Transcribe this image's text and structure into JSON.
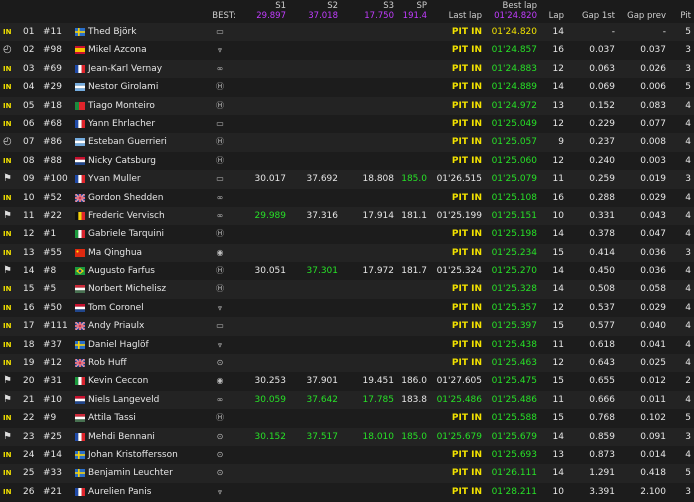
{
  "header": {
    "best_label": "BEST:",
    "col_s1": "S1",
    "col_s2": "S2",
    "col_s3": "S3",
    "col_sp": "SP",
    "col_last_lap": "Last lap",
    "col_best_lap": "Best lap",
    "col_lap": "Lap",
    "col_gap1": "Gap 1st",
    "col_gap_prev": "Gap prev",
    "col_pit": "Pit",
    "best_s1": "29.897",
    "best_s2": "37.018",
    "best_s3": "17.750",
    "best_sp": "191.4",
    "best_lap": "01'24.820"
  },
  "colors": {
    "pit_in": "#f2e200",
    "personal_best": "#27e027",
    "overall_best": "#c13cff",
    "row_odd": "#232323",
    "row_even": "#1c1c1c"
  },
  "rows": [
    {
      "status": "IN",
      "status_type": "pit",
      "pos": "01",
      "num": "#11",
      "flag": "SE",
      "name": "Thed Björk",
      "brand": "lynk",
      "s1": "",
      "s2": "",
      "s3": "",
      "sp": "",
      "last": "PIT IN",
      "best": "01'24.820",
      "best_color": "yellow",
      "lap": "14",
      "gap1": "-",
      "gap2": "-",
      "pit": "5"
    },
    {
      "status": "◴",
      "status_type": "icon",
      "pos": "02",
      "num": "#98",
      "flag": "ES",
      "name": "Mikel Azcona",
      "brand": "cupra",
      "s1": "",
      "s2": "",
      "s3": "",
      "sp": "",
      "last": "PIT IN",
      "best": "01'24.857",
      "best_color": "green",
      "lap": "16",
      "gap1": "0.037",
      "gap2": "0.037",
      "pit": "3"
    },
    {
      "status": "IN",
      "status_type": "pit",
      "pos": "03",
      "num": "#69",
      "flag": "FR",
      "name": "Jean-Karl Vernay",
      "brand": "audi",
      "s1": "",
      "s2": "",
      "s3": "",
      "sp": "",
      "last": "PIT IN",
      "best": "01'24.883",
      "best_color": "green",
      "lap": "12",
      "gap1": "0.063",
      "gap2": "0.026",
      "pit": "3"
    },
    {
      "status": "IN",
      "status_type": "pit",
      "pos": "04",
      "num": "#29",
      "flag": "AR",
      "name": "Nestor Girolami",
      "brand": "honda",
      "s1": "",
      "s2": "",
      "s3": "",
      "sp": "",
      "last": "PIT IN",
      "best": "01'24.889",
      "best_color": "green",
      "lap": "14",
      "gap1": "0.069",
      "gap2": "0.006",
      "pit": "5"
    },
    {
      "status": "IN",
      "status_type": "pit",
      "pos": "05",
      "num": "#18",
      "flag": "PT",
      "name": "Tiago Monteiro",
      "brand": "honda",
      "s1": "",
      "s2": "",
      "s3": "",
      "sp": "",
      "last": "PIT IN",
      "best": "01'24.972",
      "best_color": "green",
      "lap": "13",
      "gap1": "0.152",
      "gap2": "0.083",
      "pit": "4"
    },
    {
      "status": "IN",
      "status_type": "pit",
      "pos": "06",
      "num": "#68",
      "flag": "FR",
      "name": "Yann Ehrlacher",
      "brand": "lynk",
      "s1": "",
      "s2": "",
      "s3": "",
      "sp": "",
      "last": "PIT IN",
      "best": "01'25.049",
      "best_color": "green",
      "lap": "12",
      "gap1": "0.229",
      "gap2": "0.077",
      "pit": "4"
    },
    {
      "status": "◴",
      "status_type": "icon",
      "pos": "07",
      "num": "#86",
      "flag": "AR",
      "name": "Esteban Guerrieri",
      "brand": "honda",
      "s1": "",
      "s2": "",
      "s3": "",
      "sp": "",
      "last": "PIT IN",
      "best": "01'25.057",
      "best_color": "green",
      "lap": "9",
      "gap1": "0.237",
      "gap2": "0.008",
      "pit": "4"
    },
    {
      "status": "IN",
      "status_type": "pit",
      "pos": "08",
      "num": "#88",
      "flag": "NL",
      "name": "Nicky Catsburg",
      "brand": "hyundai",
      "s1": "",
      "s2": "",
      "s3": "",
      "sp": "",
      "last": "PIT IN",
      "best": "01'25.060",
      "best_color": "green",
      "lap": "12",
      "gap1": "0.240",
      "gap2": "0.003",
      "pit": "4"
    },
    {
      "status": "⚑",
      "status_type": "icon",
      "pos": "09",
      "num": "#100",
      "flag": "FR",
      "name": "Yvan Muller",
      "brand": "lynk",
      "s1": "30.017",
      "s1_color": "white",
      "s2": "37.692",
      "s2_color": "white",
      "s3": "18.808",
      "s3_color": "white",
      "sp": "185.0",
      "sp_color": "green",
      "last": "01'26.515",
      "last_color": "white",
      "best": "01'25.079",
      "best_color": "green",
      "lap": "11",
      "gap1": "0.259",
      "gap2": "0.019",
      "pit": "3"
    },
    {
      "status": "IN",
      "status_type": "pit",
      "pos": "10",
      "num": "#52",
      "flag": "GB",
      "name": "Gordon Shedden",
      "brand": "audi",
      "s1": "",
      "s2": "",
      "s3": "",
      "sp": "",
      "last": "PIT IN",
      "best": "01'25.108",
      "best_color": "green",
      "lap": "16",
      "gap1": "0.288",
      "gap2": "0.029",
      "pit": "4"
    },
    {
      "status": "⚑",
      "status_type": "icon",
      "pos": "11",
      "num": "#22",
      "flag": "BE",
      "name": "Frederic Vervisch",
      "brand": "audi",
      "s1": "29.989",
      "s1_color": "green",
      "s2": "37.316",
      "s2_color": "white",
      "s3": "17.914",
      "s3_color": "white",
      "sp": "181.1",
      "sp_color": "white",
      "last": "01'25.199",
      "last_color": "white",
      "best": "01'25.151",
      "best_color": "green",
      "lap": "10",
      "gap1": "0.331",
      "gap2": "0.043",
      "pit": "4"
    },
    {
      "status": "IN",
      "status_type": "pit",
      "pos": "12",
      "num": "#1",
      "flag": "IT",
      "name": "Gabriele Tarquini",
      "brand": "hyundai",
      "s1": "",
      "s2": "",
      "s3": "",
      "sp": "",
      "last": "PIT IN",
      "best": "01'25.198",
      "best_color": "green",
      "lap": "14",
      "gap1": "0.378",
      "gap2": "0.047",
      "pit": "4"
    },
    {
      "status": "IN",
      "status_type": "pit",
      "pos": "13",
      "num": "#55",
      "flag": "CN",
      "name": "Ma Qinghua",
      "brand": "alfa",
      "s1": "",
      "s2": "",
      "s3": "",
      "sp": "",
      "last": "PIT IN",
      "best": "01'25.234",
      "best_color": "green",
      "lap": "15",
      "gap1": "0.414",
      "gap2": "0.036",
      "pit": "3"
    },
    {
      "status": "⚑",
      "status_type": "icon",
      "pos": "14",
      "num": "#8",
      "flag": "BR",
      "name": "Augusto Farfus",
      "brand": "hyundai",
      "s1": "30.051",
      "s1_color": "white",
      "s2": "37.301",
      "s2_color": "green",
      "s3": "17.972",
      "s3_color": "white",
      "sp": "181.7",
      "sp_color": "white",
      "last": "01'25.324",
      "last_color": "white",
      "best": "01'25.270",
      "best_color": "green",
      "lap": "14",
      "gap1": "0.450",
      "gap2": "0.036",
      "pit": "4"
    },
    {
      "status": "IN",
      "status_type": "pit",
      "pos": "15",
      "num": "#5",
      "flag": "HU",
      "name": "Norbert Michelisz",
      "brand": "hyundai",
      "s1": "",
      "s2": "",
      "s3": "",
      "sp": "",
      "last": "PIT IN",
      "best": "01'25.328",
      "best_color": "green",
      "lap": "14",
      "gap1": "0.508",
      "gap2": "0.058",
      "pit": "4"
    },
    {
      "status": "IN",
      "status_type": "pit",
      "pos": "16",
      "num": "#50",
      "flag": "NL",
      "name": "Tom Coronel",
      "brand": "cupra",
      "s1": "",
      "s2": "",
      "s3": "",
      "sp": "",
      "last": "PIT IN",
      "best": "01'25.357",
      "best_color": "green",
      "lap": "12",
      "gap1": "0.537",
      "gap2": "0.029",
      "pit": "4"
    },
    {
      "status": "IN",
      "status_type": "pit",
      "pos": "17",
      "num": "#111",
      "flag": "GB",
      "name": "Andy Priaulx",
      "brand": "lynk",
      "s1": "",
      "s2": "",
      "s3": "",
      "sp": "",
      "last": "PIT IN",
      "best": "01'25.397",
      "best_color": "green",
      "lap": "15",
      "gap1": "0.577",
      "gap2": "0.040",
      "pit": "4"
    },
    {
      "status": "IN",
      "status_type": "pit",
      "pos": "18",
      "num": "#37",
      "flag": "SE",
      "name": "Daniel Haglöf",
      "brand": "cupra",
      "s1": "",
      "s2": "",
      "s3": "",
      "sp": "",
      "last": "PIT IN",
      "best": "01'25.438",
      "best_color": "green",
      "lap": "11",
      "gap1": "0.618",
      "gap2": "0.041",
      "pit": "4"
    },
    {
      "status": "IN",
      "status_type": "pit",
      "pos": "19",
      "num": "#12",
      "flag": "GB",
      "name": "Rob Huff",
      "brand": "vw",
      "s1": "",
      "s2": "",
      "s3": "",
      "sp": "",
      "last": "PIT IN",
      "best": "01'25.463",
      "best_color": "green",
      "lap": "12",
      "gap1": "0.643",
      "gap2": "0.025",
      "pit": "4"
    },
    {
      "status": "⚑",
      "status_type": "icon",
      "pos": "20",
      "num": "#31",
      "flag": "IT",
      "name": "Kevin Ceccon",
      "brand": "alfa",
      "s1": "30.253",
      "s1_color": "white",
      "s2": "37.901",
      "s2_color": "white",
      "s3": "19.451",
      "s3_color": "white",
      "sp": "186.0",
      "sp_color": "white",
      "last": "01'27.605",
      "last_color": "white",
      "best": "01'25.475",
      "best_color": "green",
      "lap": "15",
      "gap1": "0.655",
      "gap2": "0.012",
      "pit": "2"
    },
    {
      "status": "⚑",
      "status_type": "icon",
      "pos": "21",
      "num": "#10",
      "flag": "NL",
      "name": "Niels Langeveld",
      "brand": "audi",
      "s1": "30.059",
      "s1_color": "green",
      "s2": "37.642",
      "s2_color": "green",
      "s3": "17.785",
      "s3_color": "green",
      "sp": "183.8",
      "sp_color": "white",
      "last": "01'25.486",
      "last_color": "green",
      "best": "01'25.486",
      "best_color": "green",
      "lap": "11",
      "gap1": "0.666",
      "gap2": "0.011",
      "pit": "4"
    },
    {
      "status": "IN",
      "status_type": "pit",
      "pos": "22",
      "num": "#9",
      "flag": "HU",
      "name": "Attila Tassi",
      "brand": "honda",
      "s1": "",
      "s2": "",
      "s3": "",
      "sp": "",
      "last": "PIT IN",
      "best": "01'25.588",
      "best_color": "green",
      "lap": "15",
      "gap1": "0.768",
      "gap2": "0.102",
      "pit": "5"
    },
    {
      "status": "⚑",
      "status_type": "icon",
      "pos": "23",
      "num": "#25",
      "flag": "FR",
      "name": "Mehdi Bennani",
      "brand": "vw",
      "s1": "30.152",
      "s1_color": "green",
      "s2": "37.517",
      "s2_color": "green",
      "s3": "18.010",
      "s3_color": "green",
      "sp": "185.0",
      "sp_color": "green",
      "last": "01'25.679",
      "last_color": "green",
      "best": "01'25.679",
      "best_color": "green",
      "lap": "14",
      "gap1": "0.859",
      "gap2": "0.091",
      "pit": "3"
    },
    {
      "status": "IN",
      "status_type": "pit",
      "pos": "24",
      "num": "#14",
      "flag": "SE",
      "name": "Johan Kristoffersson",
      "brand": "vw",
      "s1": "",
      "s2": "",
      "s3": "",
      "sp": "",
      "last": "PIT IN",
      "best": "01'25.693",
      "best_color": "green",
      "lap": "13",
      "gap1": "0.873",
      "gap2": "0.014",
      "pit": "4"
    },
    {
      "status": "IN",
      "status_type": "pit",
      "pos": "25",
      "num": "#33",
      "flag": "SE",
      "name": "Benjamin Leuchter",
      "brand": "vw",
      "s1": "",
      "s2": "",
      "s3": "",
      "sp": "",
      "last": "PIT IN",
      "best": "01'26.111",
      "best_color": "green",
      "lap": "14",
      "gap1": "1.291",
      "gap2": "0.418",
      "pit": "5"
    },
    {
      "status": "IN",
      "status_type": "pit",
      "pos": "26",
      "num": "#21",
      "flag": "FR",
      "name": "Aurelien Panis",
      "brand": "cupra",
      "s1": "",
      "s2": "",
      "s3": "",
      "sp": "",
      "last": "PIT IN",
      "best": "01'28.211",
      "best_color": "green",
      "lap": "10",
      "gap1": "3.391",
      "gap2": "2.100",
      "pit": "3"
    }
  ]
}
